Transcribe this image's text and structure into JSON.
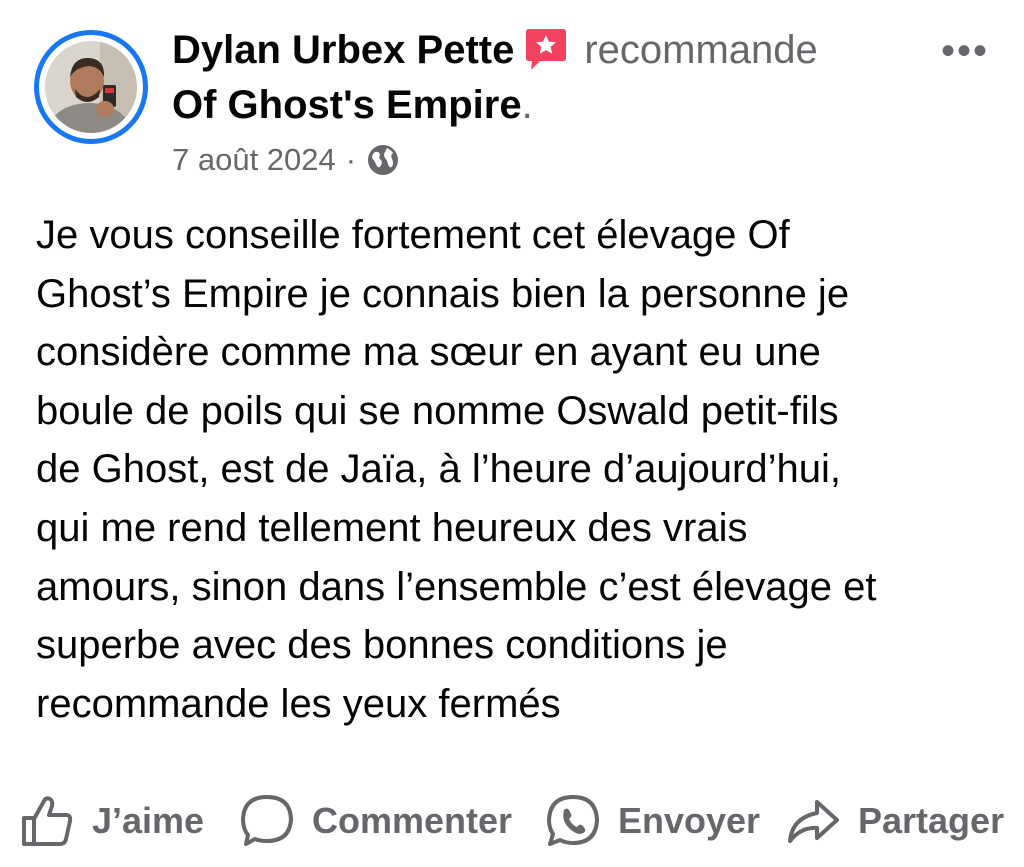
{
  "post": {
    "author": "Dylan Urbex Pette",
    "recommendation_word": "recommande",
    "page_name": "Of Ghost's Empire",
    "page_suffix": ".",
    "date": "7 août 2024",
    "date_separator": "·",
    "more_label": "•••",
    "audience_icon": "globe-icon",
    "recommend_icon": "recommendation-star-icon",
    "body": "Je vous conseille fortement cet élevage Of\nGhost’s Empire je connais bien la personne je\nconsidère comme ma sœur en ayant eu une\nboule de poils qui se nomme Oswald petit-fils\nde Ghost, est de Jaïa, à l’heure d’aujourd’hui,\nqui me rend tellement heureux des vrais\namours, sinon dans l’ensemble c’est élevage et\nsuperbe avec des bonnes conditions je\nrecommande les yeux fermés"
  },
  "actions": [
    {
      "label": "J’aime",
      "icon": "like-thumb-icon"
    },
    {
      "label": "Commenter",
      "icon": "comment-bubble-icon"
    },
    {
      "label": "Envoyer",
      "icon": "whatsapp-send-icon"
    },
    {
      "label": "Partager",
      "icon": "share-arrow-icon"
    }
  ],
  "colors": {
    "accent": "#1877f2",
    "recommend_badge": "#f3425f",
    "muted_text": "#65676b",
    "primary_text": "#050505"
  }
}
